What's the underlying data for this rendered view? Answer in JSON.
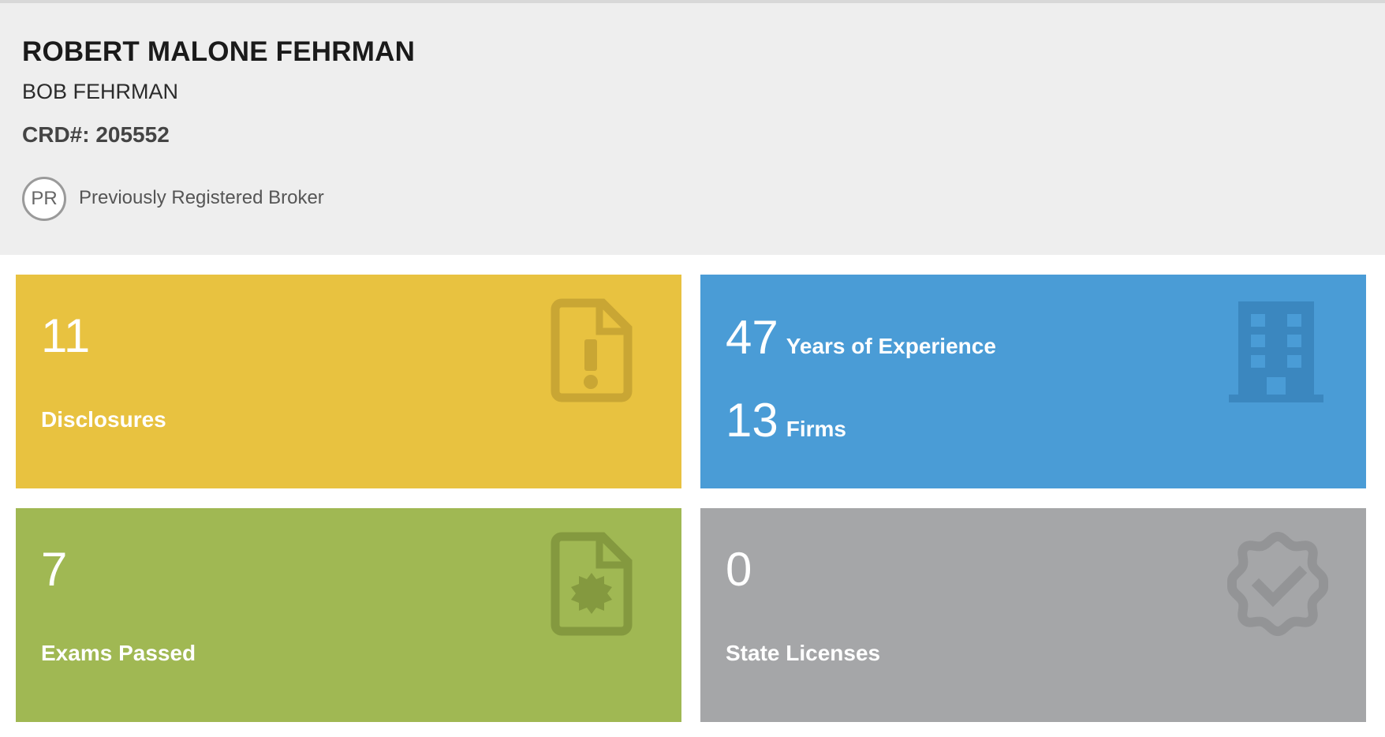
{
  "profile": {
    "full_name": "ROBERT MALONE FEHRMAN",
    "alias": "BOB FEHRMAN",
    "crd": "CRD#: 205552",
    "status_badge": "PR",
    "status_text": "Previously Registered Broker"
  },
  "tiles": {
    "disclosures": {
      "value": "11",
      "label": "Disclosures",
      "color": "#e8c240",
      "icon": "document-exclamation-icon"
    },
    "experience": {
      "years_value": "47",
      "years_label": "Years of Experience",
      "firms_value": "13",
      "firms_label": "Firms",
      "color": "#4a9cd6",
      "icon": "building-icon"
    },
    "exams": {
      "value": "7",
      "label": "Exams Passed",
      "color": "#a0b853",
      "icon": "document-seal-icon"
    },
    "licenses": {
      "value": "0",
      "label": "State Licenses",
      "color": "#a5a6a8",
      "icon": "check-seal-icon"
    }
  }
}
